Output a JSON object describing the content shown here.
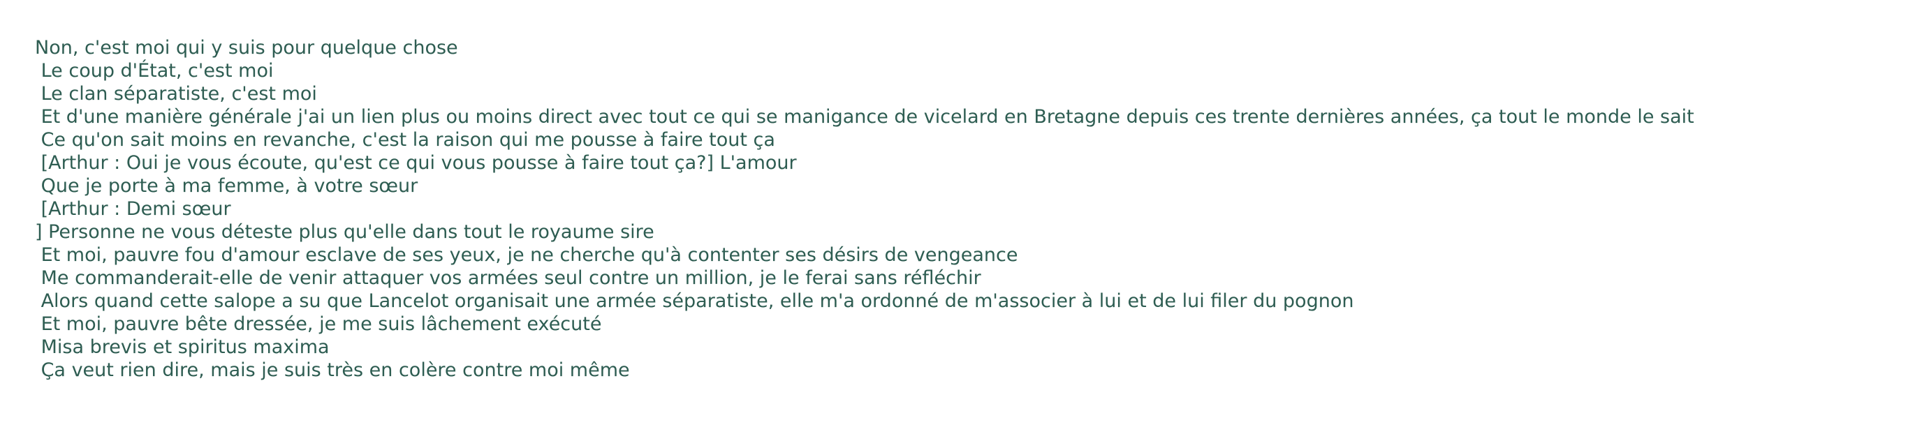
{
  "lines": [
    "Non, c'est moi qui y suis pour quelque chose",
    " Le coup d'État, c'est moi",
    " Le clan séparatiste, c'est moi",
    " Et d'une manière générale j'ai un lien plus ou moins direct avec tout ce qui se manigance de vicelard en Bretagne depuis ces trente dernières années, ça tout le monde le sait",
    " Ce qu'on sait moins en revanche, c'est la raison qui me pousse à faire tout ça",
    " [Arthur : Oui je vous écoute, qu'est ce qui vous pousse à faire tout ça?] L'amour",
    " Que je porte à ma femme, à votre sœur",
    " [Arthur : Demi sœur",
    "] Personne ne vous déteste plus qu'elle dans tout le royaume sire",
    " Et moi, pauvre fou d'amour esclave de ses yeux, je ne cherche qu'à contenter ses désirs de vengeance",
    " Me commanderait-elle de venir attaquer vos armées seul contre un million, je le ferai sans réfléchir",
    " Alors quand cette salope a su que Lancelot organisait une armée séparatiste, elle m'a ordonné de m'associer à lui et de lui filer du pognon",
    " Et moi, pauvre bête dressée, je me suis lâchement exécuté",
    " Misa brevis et spiritus maxima",
    " Ça veut rien dire, mais je suis très en colère contre moi même"
  ]
}
